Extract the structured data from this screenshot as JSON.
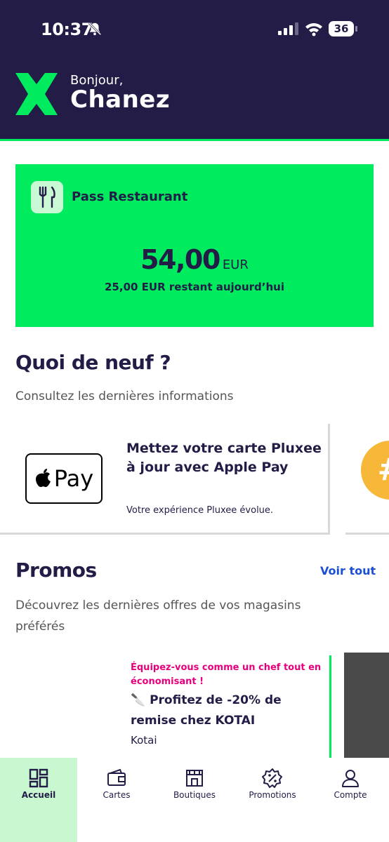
{
  "status_bar": {
    "time": "10:37",
    "battery": "36"
  },
  "header": {
    "greeting": "Bonjour,",
    "username": "Chanez"
  },
  "pass": {
    "name": "Pass Restaurant",
    "amount": "54,00",
    "currency": "EUR",
    "remaining": "25,00 EUR restant aujourd’hui"
  },
  "news": {
    "title": "Quoi de neuf ?",
    "subtitle": "Consultez les dernières informations",
    "card": {
      "badge": "Pay",
      "title": "Mettez votre carte Pluxee à jour avec Apple Pay",
      "description": "Votre expérience Pluxee évolue."
    }
  },
  "promos": {
    "title": "Promos",
    "see_all": "Voir tout",
    "subtitle": "Découvrez les dernières offres de vos magasins préférés",
    "card": {
      "tag": "Équipez-vous comme un chef tout en économisant !",
      "title": "🔪 Profitez de -20% de remise chez KOTAI",
      "merchant": "Kotai"
    }
  },
  "tabs": [
    {
      "label": "Accueil",
      "icon": "home-grid-icon",
      "active": true
    },
    {
      "label": "Cartes",
      "icon": "wallet-icon",
      "active": false
    },
    {
      "label": "Boutiques",
      "icon": "store-icon",
      "active": false
    },
    {
      "label": "Promotions",
      "icon": "discount-badge-icon",
      "active": false
    },
    {
      "label": "Compte",
      "icon": "user-icon",
      "active": false
    }
  ],
  "colors": {
    "brand_dark": "#221C46",
    "brand_green": "#00EB5E",
    "promo_pink": "#e6007e",
    "link_blue": "#1a4fd6"
  }
}
